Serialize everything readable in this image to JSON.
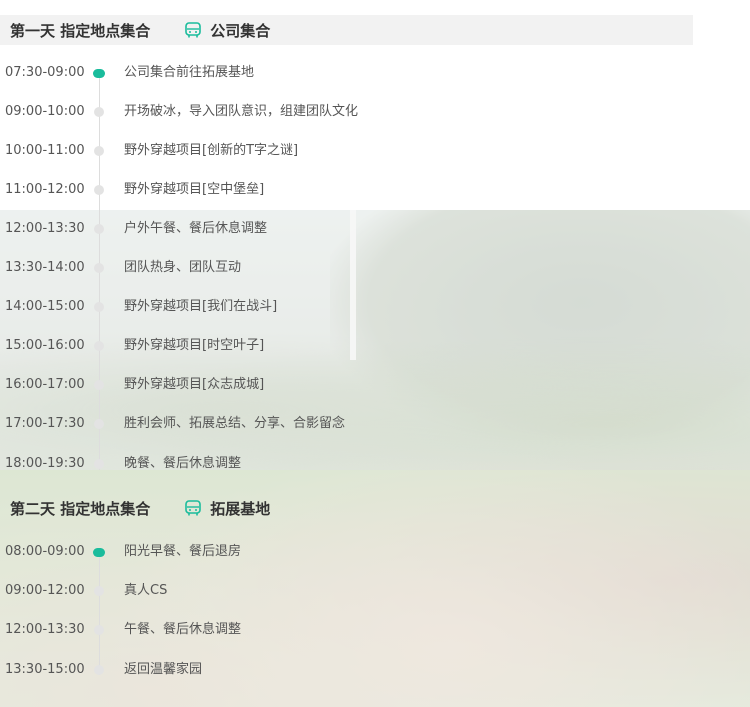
{
  "colors": {
    "accent": "#1abc9c",
    "header_bg": "#f2f2f2",
    "text": "#555555"
  },
  "days": [
    {
      "title": "第一天 指定地点集合",
      "icon": "bus-icon",
      "location": "公司集合",
      "items": [
        {
          "time": "07:30-09:00",
          "activity": "公司集合前往拓展基地"
        },
        {
          "time": "09:00-10:00",
          "activity": "开场破冰，导入团队意识，组建团队文化"
        },
        {
          "time": "10:00-11:00",
          "activity": "野外穿越项目[创新的T字之谜]"
        },
        {
          "time": "11:00-12:00",
          "activity": "野外穿越项目[空中堡垒]"
        },
        {
          "time": "12:00-13:30",
          "activity": "户外午餐、餐后休息调整"
        },
        {
          "time": "13:30-14:00",
          "activity": "团队热身、团队互动"
        },
        {
          "time": "14:00-15:00",
          "activity": "野外穿越项目[我们在战斗]"
        },
        {
          "time": "15:00-16:00",
          "activity": "野外穿越项目[时空叶子]"
        },
        {
          "time": "16:00-17:00",
          "activity": "野外穿越项目[众志成城]"
        },
        {
          "time": "17:00-17:30",
          "activity": "胜利会师、拓展总结、分享、合影留念"
        },
        {
          "time": "18:00-19:30",
          "activity": "晚餐、餐后休息调整"
        }
      ]
    },
    {
      "title": "第二天 指定地点集合",
      "icon": "bus-icon",
      "location": "拓展基地",
      "items": [
        {
          "time": "08:00-09:00",
          "activity": "阳光早餐、餐后退房"
        },
        {
          "time": "09:00-12:00",
          "activity": "真人CS"
        },
        {
          "time": "12:00-13:30",
          "activity": "午餐、餐后休息调整"
        },
        {
          "time": "13:30-15:00",
          "activity": "返回温馨家园"
        }
      ]
    }
  ]
}
